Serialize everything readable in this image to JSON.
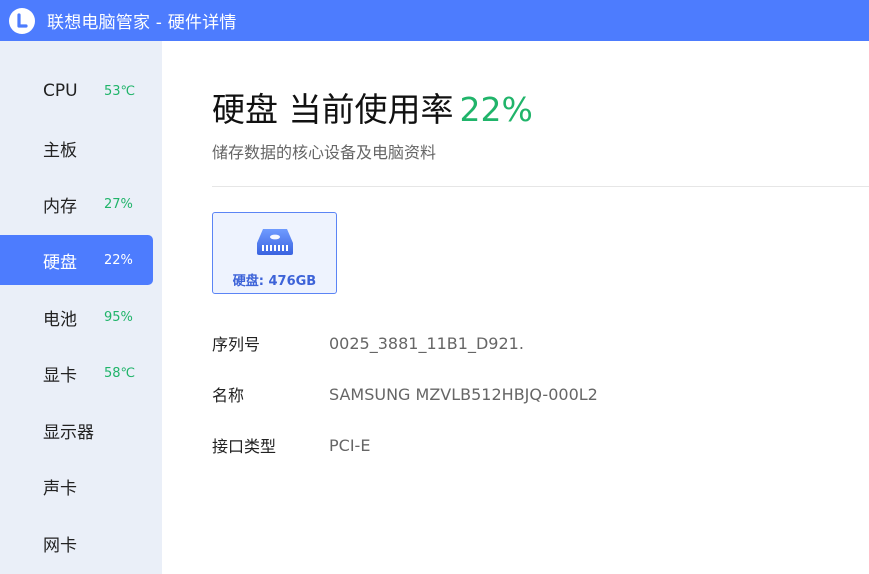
{
  "window": {
    "title": "联想电脑管家 - 硬件详情",
    "logo_icon": "lenovo-logo-icon"
  },
  "sidebar": {
    "items": [
      {
        "label": "CPU",
        "value": "53℃",
        "active": false
      },
      {
        "label": "主板",
        "value": "",
        "active": false
      },
      {
        "label": "内存",
        "value": "27%",
        "active": false
      },
      {
        "label": "硬盘",
        "value": "22%",
        "active": true
      },
      {
        "label": "电池",
        "value": "95%",
        "active": false
      },
      {
        "label": "显卡",
        "value": "58℃",
        "active": false
      },
      {
        "label": "显示器",
        "value": "",
        "active": false
      },
      {
        "label": "声卡",
        "value": "",
        "active": false
      },
      {
        "label": "网卡",
        "value": "",
        "active": false
      }
    ]
  },
  "main": {
    "heading": "硬盘 当前使用率",
    "usage": "22%",
    "subtitle": "储存数据的核心设备及电脑资料",
    "disk_card": {
      "icon": "hard-drive-icon",
      "label": "硬盘: 476GB"
    },
    "details": [
      {
        "key": "序列号",
        "value": "0025_3881_11B1_D921."
      },
      {
        "key": "名称",
        "value": "SAMSUNG MZVLB512HBJQ-000L2"
      },
      {
        "key": "接口类型",
        "value": "PCI-E"
      }
    ]
  },
  "colors": {
    "accent": "#4d7cfe",
    "good": "#20b46a",
    "sidebar_bg": "#eaeff8"
  }
}
